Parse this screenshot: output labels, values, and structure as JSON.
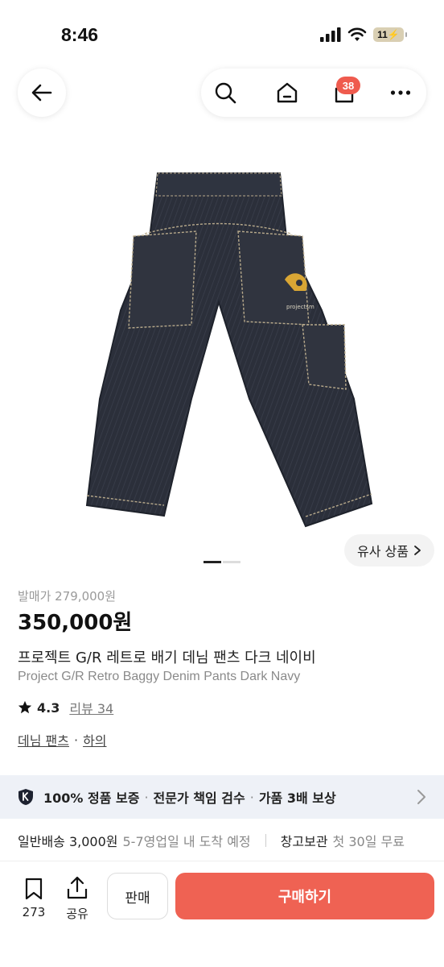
{
  "status": {
    "time": "8:46",
    "battery": "11"
  },
  "header": {
    "cart_count": "38"
  },
  "gallery": {
    "similar_label": "유사 상품",
    "logo_text": "projectsm",
    "total_images": 2,
    "current_image": 1
  },
  "product": {
    "release_price": "발매가 279,000원",
    "price": "350,000원",
    "title_ko": "프로젝트 G/R 레트로 배기 데님 팬츠 다크 네이비",
    "title_en": "Project G/R Retro Baggy Denim Pants Dark Navy",
    "rating": "4.3",
    "review_label": "리뷰 34",
    "category_1": "데님 팬츠",
    "category_sep": "·",
    "category_2": "하의"
  },
  "guarantee": {
    "item_1": "100% 정품 보증",
    "item_2": "전문가 책임 검수",
    "item_3": "가품 3배 보상",
    "sep": "·"
  },
  "delivery": {
    "standard_label": "일반배송 3,000원",
    "standard_note": "5-7영업일 내 도착 예정",
    "storage_label": "창고보관",
    "storage_note": "첫 30일 무료"
  },
  "bottom_bar": {
    "bookmark_count": "273",
    "share_label": "공유",
    "sell_label": "판매",
    "buy_label": "구매하기"
  },
  "colors": {
    "accent": "#ef6253",
    "badge": "#ef5b4e",
    "guarantee_bg": "#eef1f7",
    "denim": "#2b2f3a"
  }
}
